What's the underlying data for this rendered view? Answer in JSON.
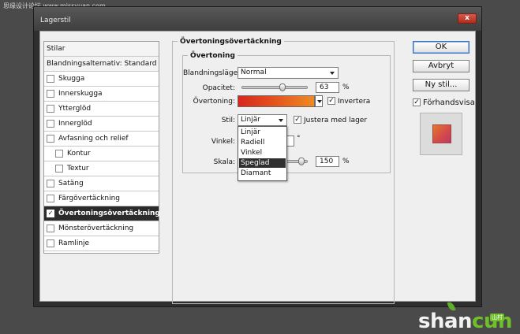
{
  "watermark": "思缘设计论坛 www.missyuan.com",
  "window": {
    "title": "Lagerstil",
    "close": "x"
  },
  "list": {
    "header1": "Stilar",
    "header2": "Blandningsalternativ: Standard",
    "items": [
      {
        "label": "Skugga",
        "checked": false
      },
      {
        "label": "Innerskugga",
        "checked": false
      },
      {
        "label": "Ytterglöd",
        "checked": false
      },
      {
        "label": "Innerglöd",
        "checked": false
      },
      {
        "label": "Avfasning och relief",
        "checked": false
      },
      {
        "label": "Kontur",
        "checked": false
      },
      {
        "label": "Textur",
        "checked": false
      },
      {
        "label": "Satäng",
        "checked": false
      },
      {
        "label": "Färgövertäckning",
        "checked": false
      },
      {
        "label": "Övertoningsövertäckning",
        "checked": true
      },
      {
        "label": "Mönsterövertäckning",
        "checked": false
      },
      {
        "label": "Ramlinje",
        "checked": false
      }
    ]
  },
  "panel": {
    "title": "Övertoningsövertäckning",
    "subtitle": "Övertoning",
    "blend_mode_label": "Blandningsläge:",
    "blend_mode_value": "Normal",
    "opacity_label": "Opacitet:",
    "opacity_value": "63",
    "opacity_fraction": 0.63,
    "gradient_label": "Övertoning:",
    "reverse_label": "Invertera",
    "reverse_checked": true,
    "style_label": "Stil:",
    "style_value": "Linjär",
    "align_label": "Justera med lager",
    "align_checked": true,
    "angle_label": "Vinkel:",
    "angle_unit": "°",
    "scale_label": "Skala:",
    "scale_value": "150",
    "scale_fraction": 0.5,
    "percent_unit": "%",
    "style_options": [
      "Linjär",
      "Radiell",
      "Vinkel",
      "Speglad",
      "Diamant"
    ],
    "highlighted_option": "Speglad"
  },
  "buttons": {
    "ok": "OK",
    "cancel": "Avbryt",
    "new_style": "Ny stil...",
    "preview_label": "Förhandsvisa",
    "preview_checked": true
  },
  "logo": {
    "shan": "shan",
    "cun": "cun",
    "sub": "山村"
  },
  "colors": {
    "gradient_start": "#d8261d",
    "gradient_end": "#ee8a24",
    "selection": "#2b2b2b",
    "logo_green": "#6fbf2a"
  }
}
